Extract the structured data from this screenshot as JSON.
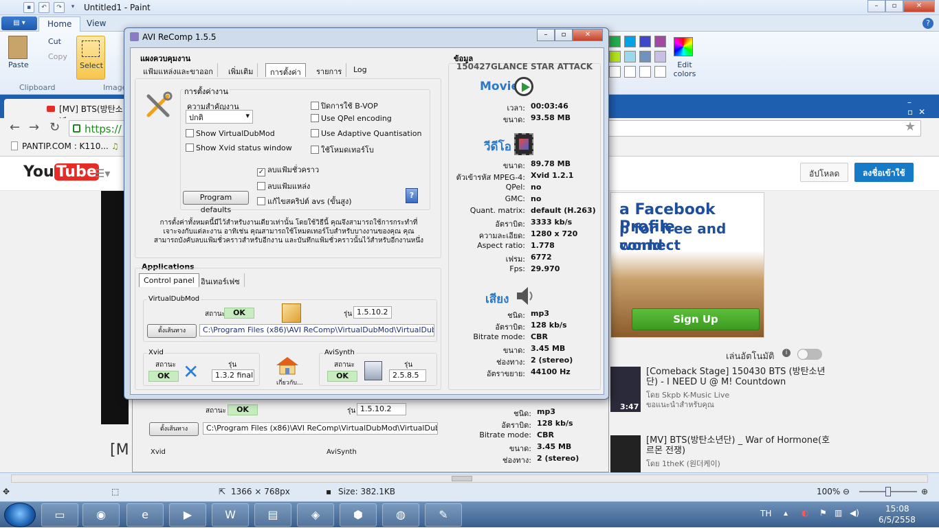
{
  "paint": {
    "title": "Untitled1 - Paint",
    "tabs": [
      "Home",
      "View"
    ],
    "clipboard": {
      "paste": "Paste",
      "cut": "Cut",
      "copy": "Copy",
      "group": "Clipboard"
    },
    "image": {
      "select": "Select",
      "group": "Image"
    },
    "edit_colors": "Edit colors",
    "status": {
      "dimensions": "1366 × 768px",
      "size": "Size: 382.1KB",
      "zoom": "100%"
    }
  },
  "browser": {
    "tab_title": "[MV] BTS(방탄소년",
    "url_prefix": "https://",
    "bookmark1": "PANTIP.COM : K110...",
    "upload": "อัปโหลด",
    "signin": "ลงชื่อเข้าใช้",
    "ad": {
      "line1": "a Facebook Profile",
      "line2": "p for free and connect",
      "line3": "world",
      "signup": "Sign Up"
    },
    "autoplay": "เล่นอัตโนมัติ",
    "related": [
      {
        "title": "[Comeback Stage] 150430 BTS (방탄소년단) - I NEED U @ M! Countdown",
        "by": "โดย Skpb K-Music Live",
        "by2": "ขอแนะนำสำหรับคุณ",
        "dur": "3:47"
      },
      {
        "title": "[MV] BTS(방탄소년단) _ War of Hormone(호르몬 전쟁)",
        "by": "โดย 1theK (원더케이)",
        "by2": "",
        "dur": ""
      }
    ]
  },
  "avi": {
    "title": "AVI ReComp  1.5.5",
    "control_group": "แผงควบคุมงาน",
    "tabs": [
      "แฟ้มแหล่งและขาออก",
      "เพิ่มเติม",
      "การตั้งค่า",
      "รายการ",
      "Log"
    ],
    "settings_group": "การตั้งค่างาน",
    "priority_label": "ความสำคัญงาน",
    "priority_value": "ปกติ",
    "checks": {
      "show_vdm": "Show VirtualDubMod",
      "show_xvid": "Show Xvid status window",
      "disable_bvop": "ปิดการใช้ B-VOP",
      "use_qpel": "Use QPel encoding",
      "use_aq": "Use Adaptive Quantisation",
      "turbo": "ใช้โหมดเทอร์โบ",
      "delete_temp": "ลบแฟ้มชั่วคราว",
      "delete_source": "ลบแฟ้มแหล่ง",
      "edit_avs": "แก้ไขสคริปต์ avs (ขั้นสูง)"
    },
    "program_defaults": "Program defaults",
    "help_text": "การตั้งค่าทั้งหมดนี้มีไว้สำหรับงานเดียวเท่านั้น โดยใช้วิธีนี้ คุณจึงสามารถใช้การกระทำที่เจาะจงกับแต่ละงาน อาทิเช่น คุณสามารถใช้โหมดเทอร์โบสำหรับบางงานของคุณ คุณสามารถบังคับลบแฟ้มชั่วคราวสำหรับอีกงาน และบันทึกแฟ้มชั่วคราวนั้นไว้สำหรับอีกงานหนึ่ง",
    "apps_group": "Applications",
    "apps_tabs": [
      "Control panel",
      "อินเทอร์เฟซ"
    ],
    "vdm": {
      "label": "VirtualDubMod",
      "status_label": "สถานะ",
      "status": "OK",
      "version_label": "รุ่น",
      "version": "1.5.10.2",
      "set_path": "ตั้งเส้นทาง",
      "path": "C:\\Program Files (x86)\\AVI ReComp\\VirtualDubMod\\VirtualDubMod.exe"
    },
    "xvid": {
      "label": "Xvid",
      "status_label": "สถานะ",
      "status": "OK",
      "version_label": "รุ่น",
      "version": "1.3.2 final"
    },
    "about": "เกี่ยวกับ...",
    "avisynth": {
      "label": "AviSynth",
      "status_label": "สถานะ",
      "status": "OK",
      "version_label": "รุ่น",
      "version": "2.5.8.5"
    },
    "info": {
      "header": "ข้อมูล",
      "file": "150427GLANCE STAR ATTACK",
      "movie": "Movie",
      "video": "วีดีโอ",
      "audio": "เสียง",
      "movie_rows": [
        [
          "เวลา:",
          "00:03:46"
        ],
        [
          "ขนาด:",
          "93.58 MB"
        ]
      ],
      "video_rows": [
        [
          "ขนาด:",
          "89.78 MB"
        ],
        [
          "ตัวเข้ารหัส MPEG-4:",
          "Xvid 1.2.1"
        ],
        [
          "QPel:",
          "no"
        ],
        [
          "GMC:",
          "no"
        ],
        [
          "Quant. matrix:",
          "default (H.263)"
        ],
        [
          "อัตราบิต:",
          "3333 kb/s"
        ],
        [
          "ความละเอียด:",
          "1280 x 720"
        ],
        [
          "Aspect ratio:",
          "1.778"
        ],
        [
          "เฟรม:",
          "6772"
        ],
        [
          "Fps:",
          "29.970"
        ]
      ],
      "audio_rows": [
        [
          "ชนิด:",
          "mp3"
        ],
        [
          "อัตราบิต:",
          "128 kb/s"
        ],
        [
          "Bitrate mode:",
          "CBR"
        ],
        [
          "ขนาด:",
          "3.45 MB"
        ],
        [
          "ช่องทาง:",
          "2 (stereo)"
        ],
        [
          "อัตราขยาย:",
          "44100 Hz"
        ]
      ]
    }
  },
  "taskbar": {
    "lang": "TH",
    "time": "15:08",
    "date": "6/5/2558"
  }
}
